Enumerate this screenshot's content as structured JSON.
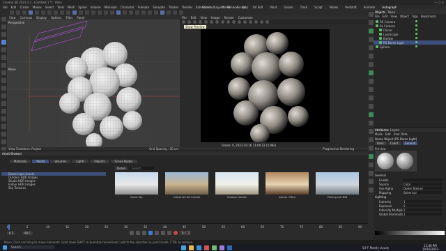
{
  "window": {
    "title": "Cinema 4D 2023.2.2 - [Untitled 1 *] - Main",
    "project_tab": "Untitled 1 *"
  },
  "menu": [
    "File",
    "Edit",
    "Create",
    "Modes",
    "Select",
    "Tools",
    "Mesh",
    "Spline",
    "Volume",
    "MoGraph",
    "Character",
    "Animate",
    "Simulate",
    "Tracker",
    "Render",
    "Extensions",
    "Layout",
    "Window",
    "Help"
  ],
  "menu_right": [
    "Standard",
    "Model",
    "Sculpt",
    "UV Edit",
    "Paint",
    "Groom",
    "Track",
    "Script",
    "Nodes",
    "Redshift",
    "Animate",
    "Autograph"
  ],
  "viewport_left": {
    "menu": [
      "View",
      "Cameras",
      "Display",
      "Options",
      "Filter",
      "Panel"
    ],
    "camera": "Perspective",
    "footer_left": "View Transform: Project",
    "footer_right": "Grid Spacing : 50 cm",
    "axis_label": "Move"
  },
  "viewport_right": {
    "menu": [
      "File",
      "Edit",
      "View",
      "Image",
      "Render",
      "Customize"
    ],
    "tooltip": "Show Preview",
    "footer_text": "Frame: 0,  2023-10-16  11:00:22  (2.96s)",
    "footer_right": "Progressive Rendering"
  },
  "objects_panel": {
    "tabs": [
      "Objects",
      "Takes"
    ],
    "menu": [
      "File",
      "Edit",
      "View",
      "Object",
      "Tags",
      "Bookmarks"
    ],
    "items": [
      {
        "name": "RS Camera"
      },
      {
        "name": "Rs Camera"
      },
      {
        "name": "Cloner"
      },
      {
        "name": "Landscape"
      },
      {
        "name": "Emitter"
      },
      {
        "name": "RS Dome Light"
      },
      {
        "name": "Sphere"
      }
    ]
  },
  "attributes_panel": {
    "tabs": [
      "Attributes",
      "Layers"
    ],
    "menu": [
      "Mode",
      "Edit",
      "User Data"
    ],
    "object_label": "Dome Object [RS Dome Light]",
    "sub_tabs": [
      "Basic",
      "Coord.",
      "General"
    ],
    "preview_label": "Preview",
    "section": "General",
    "fields": [
      {
        "label": "Enable",
        "value": ""
      },
      {
        "label": "Source",
        "value": "Color"
      },
      {
        "label": "Use Alpha",
        "value": "Dome Texture"
      },
      {
        "label": "Mapping",
        "value": "Spherical"
      }
    ],
    "section2": "Lighting",
    "fields2": [
      {
        "label": "Intensity",
        "value": "1"
      },
      {
        "label": "Exposure",
        "value": "0"
      },
      {
        "label": "Intensity Multiplier",
        "value": "1"
      },
      {
        "label": "Global Illumination",
        "value": "1"
      }
    ]
  },
  "asset_browser": {
    "tabs": [
      "Asset Browser"
    ],
    "category_tabs": [
      "Materials",
      "Media",
      "Volumes",
      "Lights",
      "Objects",
      "Scene Nodes"
    ],
    "search_placeholder": "Search",
    "path": "Dome",
    "categories": [
      "Dome Light Assets",
      "Outdoor HDR Images",
      "Studio HDR Images",
      "Indoor HDR Images",
      "Sky Textures"
    ],
    "assets": [
      {
        "label": "Dome Sky"
      },
      {
        "label": "Industrial Hall Outside"
      },
      {
        "label": "Outdoor Garden"
      },
      {
        "label": "Interior Office"
      },
      {
        "label": "Parking Lot HDR"
      }
    ]
  },
  "timeline": {
    "frame_start": "0 F",
    "frame_end": "90 F",
    "current": "0 F",
    "ticks": [
      "0",
      "5",
      "10",
      "15",
      "20",
      "25",
      "30",
      "35",
      "40",
      "45",
      "50",
      "55",
      "60",
      "65",
      "70",
      "75",
      "80",
      "85",
      "90"
    ]
  },
  "status_bar": {
    "text": "Move: Click and drag to move elements. Hold down SHIFT to quantize movement / add to the selection in point mode. CTRL to remove."
  },
  "taskbar": {
    "search": "Search",
    "weather": "54°F  Mostly cloudy",
    "time": "11:00 PM",
    "date": "10/16/2023"
  }
}
